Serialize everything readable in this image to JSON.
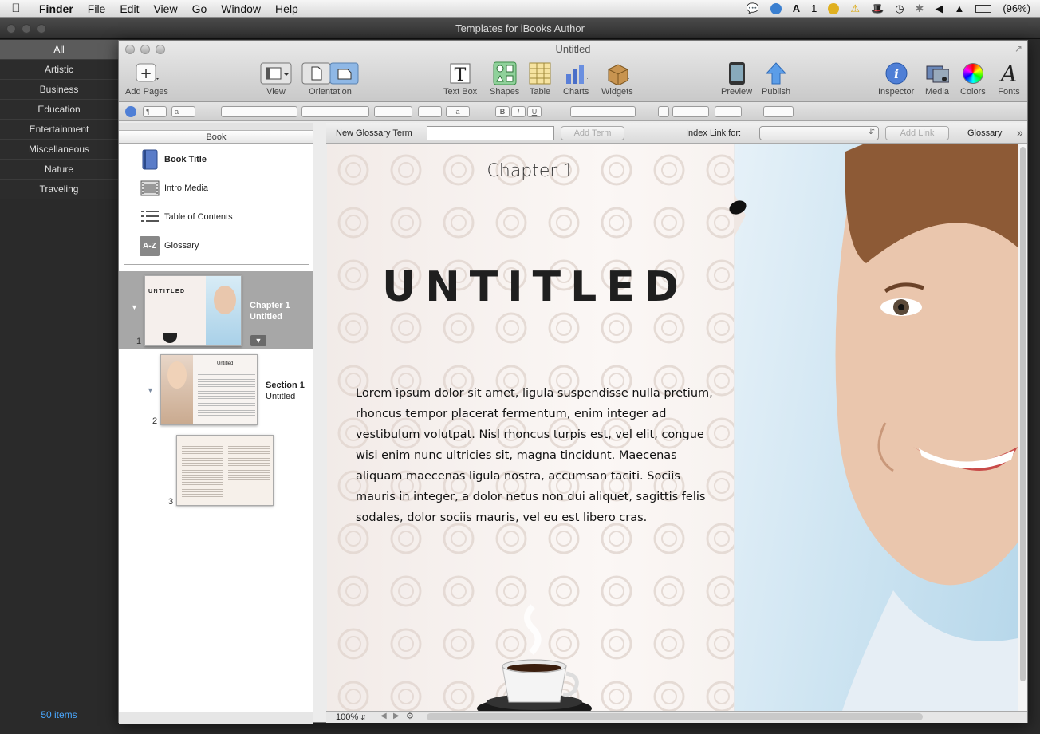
{
  "menubar": {
    "app": "Finder",
    "items": [
      "File",
      "Edit",
      "View",
      "Go",
      "Window",
      "Help"
    ],
    "adobe_count": "1",
    "battery": "(96%)"
  },
  "back_window": {
    "title": "Templates for iBooks Author",
    "categories": [
      "All",
      "Artistic",
      "Business",
      "Education",
      "Entertainment",
      "Miscellaneous",
      "Nature",
      "Traveling"
    ],
    "selected_category": "All",
    "item_count": "50 items"
  },
  "window": {
    "title": "Untitled",
    "toolbar": {
      "add_pages": "Add Pages",
      "view": "View",
      "orientation": "Orientation",
      "text_box": "Text Box",
      "shapes": "Shapes",
      "table": "Table",
      "charts": "Charts",
      "widgets": "Widgets",
      "preview": "Preview",
      "publish": "Publish",
      "inspector": "Inspector",
      "media": "Media",
      "colors": "Colors",
      "fonts": "Fonts"
    },
    "format": {
      "para_style": "¶",
      "char_style": "a",
      "char_style_btn": "a",
      "bold": "B",
      "italic": "I",
      "underline": "U"
    }
  },
  "sidebar": {
    "header": "Book",
    "book_items": [
      "Book Title",
      "Intro Media",
      "Table of Contents",
      "Glossary"
    ],
    "glossary_icon_text": "A-Z",
    "chapter": {
      "number": "1",
      "title": "Chapter 1",
      "subtitle": "Untitled"
    },
    "section": {
      "number": "2",
      "title": "Section 1",
      "subtitle": "Untitled"
    },
    "page3_number": "3",
    "thumb_title": "UNTITLED",
    "thumb_heading": "Untitled"
  },
  "glossary_bar": {
    "new_term_label": "New Glossary Term",
    "new_term_value": "",
    "add_term": "Add Term",
    "index_link_label": "Index Link for:",
    "index_link_value": "",
    "add_link": "Add Link",
    "glossary": "Glossary"
  },
  "page": {
    "chapter_label": "Chapter 1",
    "title": "UNTITLED",
    "body": "Lorem ipsum dolor sit amet, ligula suspendisse nulla pretium, rhoncus tempor placerat fermentum, enim integer ad vestibulum volutpat. Nisl rhoncus turpis est, vel elit, congue wisi enim nunc ultricies sit, magna tincidunt. Maecenas aliquam maecenas ligula nostra, accumsan taciti. Sociis mauris in integer, a dolor netus non dui aliquet, sagittis felis sodales, dolor sociis mauris, vel eu est libero cras."
  },
  "bottom": {
    "zoom": "100%"
  },
  "colors": {
    "accent": "#4aa8ff",
    "selection_gray": "#a7a7a7"
  }
}
